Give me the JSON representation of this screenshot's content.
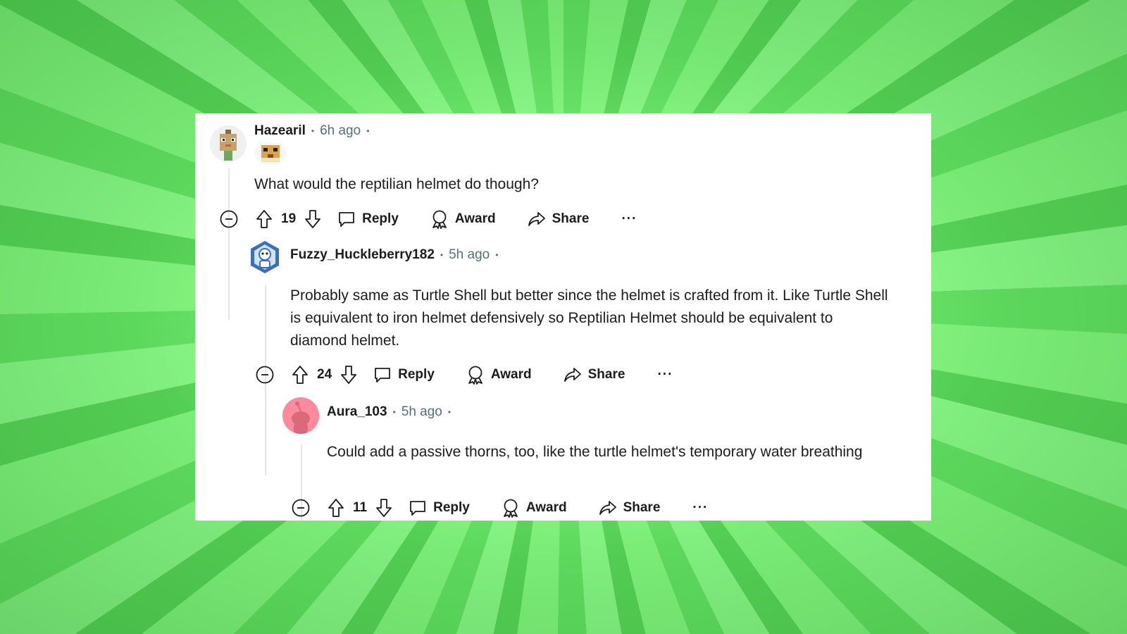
{
  "comments": [
    {
      "username": "Hazearil",
      "time": "6h ago",
      "text": "What would the reptilian helmet do though?",
      "score": "19",
      "actions": {
        "reply": "Reply",
        "award": "Award",
        "share": "Share",
        "more": "···"
      }
    },
    {
      "username": "Fuzzy_Huckleberry182",
      "time": "5h ago",
      "text": "Probably same as Turtle Shell but better since the helmet is crafted from it. Like Turtle Shell is equivalent to iron helmet defensively so Reptilian Helmet should be equivalent to diamond helmet.",
      "score": "24",
      "actions": {
        "reply": "Reply",
        "award": "Award",
        "share": "Share",
        "more": "···"
      }
    },
    {
      "username": "Aura_103",
      "time": "5h ago",
      "text": "Could add a passive thorns, too, like the turtle helmet's temporary water breathing",
      "score": "11",
      "actions": {
        "reply": "Reply",
        "award": "Award",
        "share": "Share",
        "more": "···"
      }
    }
  ],
  "separator": "•",
  "colors": {
    "background": "#6fe86c",
    "card": "#ffffff",
    "text": "#1c1c1c",
    "meta": "#576f76",
    "thread_line": "#e3e6e8",
    "aura_avatar": "#ff8a9e"
  },
  "icons": [
    "collapse-icon",
    "upvote-icon",
    "downvote-icon",
    "comment-icon",
    "award-icon",
    "share-icon",
    "more-icon"
  ]
}
